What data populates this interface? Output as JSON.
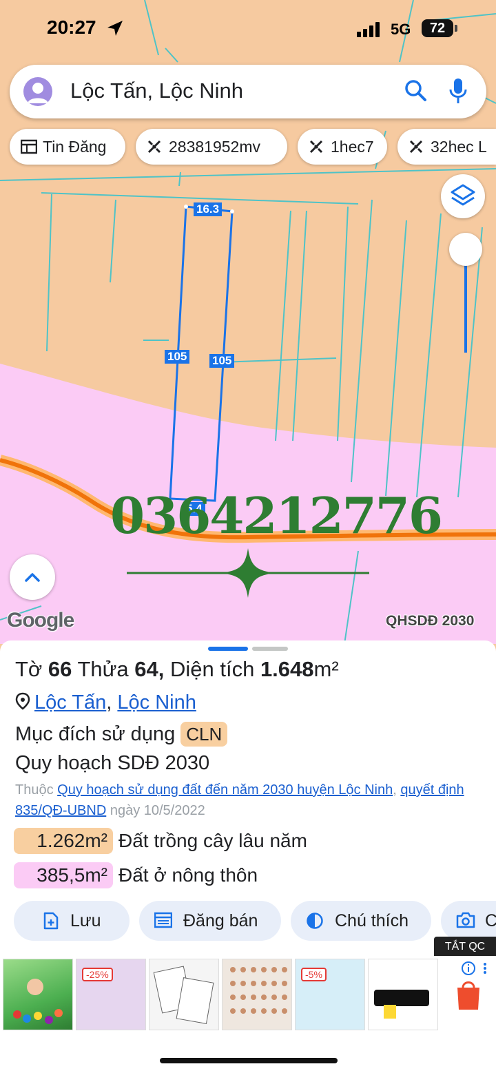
{
  "status": {
    "time": "20:27",
    "network": "5G",
    "battery": "72"
  },
  "search": {
    "query": "Lộc Tấn, Lộc Ninh"
  },
  "chips": [
    {
      "label": "Tin Đăng",
      "icon": "list-icon"
    },
    {
      "label": "28381952mv",
      "icon": "ruler-icon"
    },
    {
      "label": "1hec7",
      "icon": "ruler-icon"
    },
    {
      "label": "32hec L",
      "icon": "ruler-icon"
    }
  ],
  "map": {
    "edge_labels": {
      "top": "16.3",
      "left": "105",
      "right": "105",
      "bottom": "5.4"
    },
    "watermark_phone": "0364212776",
    "logo": "Google",
    "layer_label": "QHSDĐ 2030",
    "colors": {
      "land": "#f6caa0",
      "residential": "#fbcbf5",
      "parcel": "#1a73e8",
      "road": "#f0730a"
    }
  },
  "parcel": {
    "title_prefix": "Tờ",
    "sheet": "66",
    "lot_prefix": "Thửa",
    "lot": "64,",
    "area_prefix": "Diện tích",
    "area": "1.648",
    "area_unit": "m²",
    "commune": "Lộc Tấn",
    "separator": ",",
    "district": "Lộc Ninh",
    "purpose_label": "Mục đích sử dụng",
    "purpose_code": "CLN",
    "plan_label": "Quy hoạch SDĐ 2030",
    "belongs_prefix": "Thuộc",
    "plan_link": "Quy hoạch sử dụng đất đến năm 2030 huyện Lộc Ninh",
    "comma": ",",
    "decision_link": "quyết định 835/QĐ-UBND",
    "date_text": "ngày 10/5/2022",
    "zones": [
      {
        "area": "1.262m²",
        "label": "Đất trồng cây lâu năm",
        "color": "#f8cfa0"
      },
      {
        "area": "385,5m²",
        "label": "Đất ở nông thôn",
        "color": "#fbcbf5"
      }
    ]
  },
  "actions": [
    {
      "label": "Lưu",
      "icon": "add-file-icon"
    },
    {
      "label": "Đăng bán",
      "icon": "listing-icon"
    },
    {
      "label": "Chú thích",
      "icon": "legend-icon"
    },
    {
      "label": "C",
      "icon": "camera-icon"
    }
  ],
  "ads": {
    "close_label": "TẮT QC",
    "discounts": [
      "-25%",
      "-5%"
    ]
  }
}
